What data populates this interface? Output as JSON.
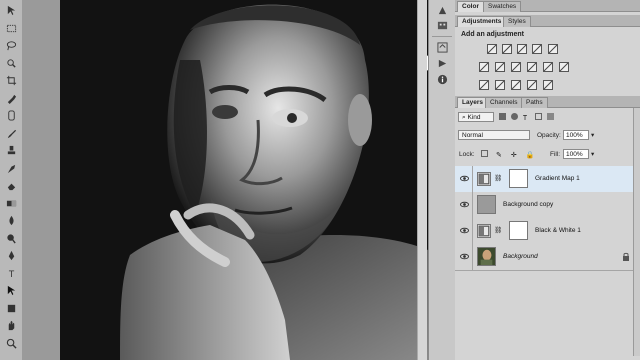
{
  "tools": [
    {
      "name": "move-tool-icon"
    },
    {
      "name": "marquee-tool-icon"
    },
    {
      "name": "lasso-tool-icon"
    },
    {
      "name": "quick-select-tool-icon"
    },
    {
      "name": "crop-tool-icon"
    },
    {
      "name": "eyedropper-tool-icon"
    },
    {
      "name": "healing-brush-tool-icon"
    },
    {
      "name": "brush-tool-icon"
    },
    {
      "name": "clone-stamp-tool-icon"
    },
    {
      "name": "history-brush-tool-icon"
    },
    {
      "name": "eraser-tool-icon"
    },
    {
      "name": "gradient-tool-icon"
    },
    {
      "name": "blur-tool-icon"
    },
    {
      "name": "dodge-tool-icon"
    },
    {
      "name": "pen-tool-icon"
    },
    {
      "name": "type-tool-icon"
    },
    {
      "name": "path-select-tool-icon"
    },
    {
      "name": "shape-tool-icon"
    },
    {
      "name": "hand-tool-icon"
    },
    {
      "name": "zoom-tool-icon"
    }
  ],
  "top_tabs": {
    "color": "Color",
    "swatches": "Swatches"
  },
  "adjust_tabs": {
    "adjustments": "Adjustments",
    "styles": "Styles"
  },
  "adjustments": {
    "title": "Add an adjustment",
    "row1": [
      "brightness-contrast-icon",
      "levels-icon",
      "curves-icon",
      "exposure-icon",
      "vibrance-icon"
    ],
    "row2": [
      "hue-saturation-icon",
      "color-balance-icon",
      "black-white-icon",
      "photo-filter-icon",
      "channel-mixer-icon",
      "color-lookup-icon"
    ],
    "row3": [
      "invert-icon",
      "posterize-icon",
      "threshold-icon",
      "gradient-map-icon",
      "selective-color-icon"
    ]
  },
  "layers_tabs": {
    "layers": "Layers",
    "channels": "Channels",
    "paths": "Paths"
  },
  "filter": {
    "kind": "Kind"
  },
  "blend": {
    "mode": "Normal",
    "opacity_label": "Opacity:",
    "opacity": "100%",
    "lock_label": "Lock:",
    "fill_label": "Fill:",
    "fill": "100%"
  },
  "layers": [
    {
      "name": "Gradient Map 1",
      "selected": true
    },
    {
      "name": "Background copy",
      "selected": false
    },
    {
      "name": "Black & White 1",
      "selected": false
    },
    {
      "name": "Background",
      "selected": false
    }
  ],
  "colors": {
    "selected_row": "#dbe8f4",
    "panel_bg": "#d4d4d4"
  }
}
